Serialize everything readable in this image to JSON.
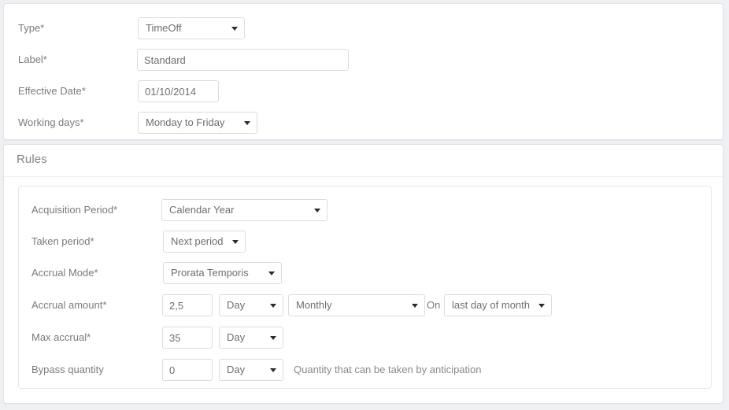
{
  "general": {
    "fields": [
      {
        "label": "Type*",
        "control": "select",
        "value": "TimeOff"
      },
      {
        "label": "Label*",
        "control": "input",
        "value": "Standard"
      },
      {
        "label": "Effective Date*",
        "control": "input",
        "value": "01/10/2014"
      },
      {
        "label": "Working days*",
        "control": "select",
        "value": "Monday to Friday"
      }
    ]
  },
  "rules": {
    "title": "Rules",
    "acquisition_period": {
      "label": "Acquisition Period*",
      "value": "Calendar Year"
    },
    "taken_period": {
      "label": "Taken period*",
      "value": "Next period"
    },
    "accrual_mode": {
      "label": "Accrual Mode*",
      "value": "Prorata Temporis"
    },
    "accrual_amount": {
      "label": "Accrual amount*",
      "amount": "2,5",
      "unit": "Day",
      "frequency": "Monthly",
      "on_label": "On",
      "on_value": "last day of month"
    },
    "max_accrual": {
      "label": "Max accrual*",
      "amount": "35",
      "unit": "Day"
    },
    "bypass_quantity": {
      "label": "Bypass quantity",
      "amount": "0",
      "unit": "Day",
      "hint": "Quantity that can be taken by anticipation"
    }
  },
  "icons": {
    "caret": "chevron-down-icon"
  },
  "colors": {
    "page_background": "#eef0f4",
    "panel_background": "#ffffff",
    "panel_border": "#e2e2e2",
    "field_border": "#dcdcdc",
    "label_text": "#7b7b7b",
    "value_text": "#6f6f6f"
  }
}
